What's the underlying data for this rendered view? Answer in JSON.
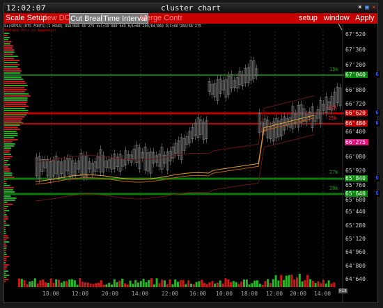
{
  "titlebar": {
    "clock": "12:02:07",
    "title": "cluster chart"
  },
  "menu": {
    "scale_setup": "Scale Setup",
    "view_dom": "View DOM",
    "cut_breaks": "Cut Breaks",
    "time_interval": "Time Interval",
    "merge_contr": "Merge Contr",
    "setup": "setup",
    "window": "window",
    "apply": "Apply"
  },
  "info": {
    "line1": "Si(SEP16)(RTS FORTS)(1 HOUR) USD/RUR 66'275 Vol=19'980'443 H/L=68'299/64'060 O/C=66'266/66'275",
    "line2": "Bid-Ask Vols by Aggressor"
  },
  "price_labels": [
    "67'520",
    "67'360",
    "67'200",
    "67'040",
    "66'880",
    "66'720",
    "66'620",
    "66'480",
    "66'400",
    "66'275",
    "66'080",
    "65'920",
    "65'840",
    "65'760",
    "65'640",
    "65'600",
    "65'440",
    "65'280",
    "65'120",
    "64'960",
    "64'800",
    "64'640"
  ],
  "levels": {
    "l1_price": "67'040",
    "l1_vol": "15k",
    "l2_price": "66'620",
    "l2_vol": "-52k",
    "l3_price": "66'480",
    "l3_vol": "-25k",
    "l4_price": "65'840",
    "l4_vol": "27k",
    "l5_price": "65'640",
    "l5_vol": "28k",
    "current": "66'275",
    "badge": "G"
  },
  "time_labels": [
    "18:00",
    "12:00",
    "20:00",
    "14:00",
    "22:00",
    "16:00",
    "10:00",
    "18:00",
    "12:00",
    "20:00",
    "14:00"
  ],
  "footer": {
    "fix": "FIX"
  },
  "colors": {
    "menu_bg": "#c80000",
    "green_level": "#0a8a0a",
    "red_level": "#c40000",
    "current": "#e0147c"
  }
}
